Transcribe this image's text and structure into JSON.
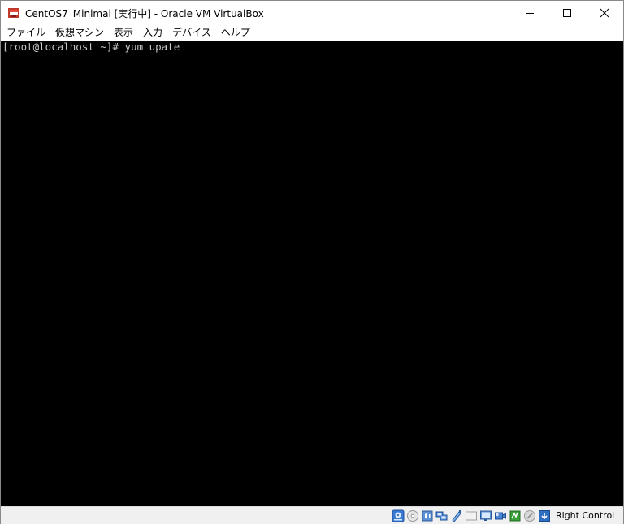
{
  "window": {
    "title": "CentOS7_Minimal [実行中] - Oracle VM VirtualBox"
  },
  "menu": {
    "items": [
      {
        "label": "ファイル"
      },
      {
        "label": "仮想マシン"
      },
      {
        "label": "表示"
      },
      {
        "label": "入力"
      },
      {
        "label": "デバイス"
      },
      {
        "label": "ヘルプ"
      }
    ]
  },
  "console": {
    "line": "[root@localhost ~]# yum upate"
  },
  "statusbar": {
    "host_key": "Right Control",
    "icons": [
      "hard-disk-icon",
      "optical-drive-icon",
      "audio-icon",
      "network-icon",
      "usb-icon",
      "shared-folders-icon",
      "display-icon",
      "video-capture-icon",
      "cpu-virtualization-icon",
      "mouse-integration-icon",
      "keyboard-capture-icon"
    ]
  },
  "colors": {
    "console_bg": "#000000",
    "console_text": "#c8c8c8",
    "titlebar_bg": "#ffffff",
    "statusbar_bg": "#f0f0f0"
  }
}
